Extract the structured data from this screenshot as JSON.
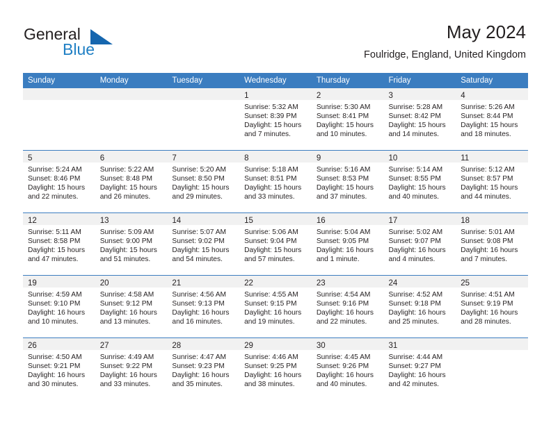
{
  "brand": {
    "name_part1": "General",
    "name_part2": "Blue",
    "triangle_icon": "triangle-icon",
    "accent_color": "#1666ae",
    "blue_text_color": "#1f7fc4"
  },
  "header": {
    "title": "May 2024",
    "subtitle": "Foulridge, England, United Kingdom"
  },
  "theme": {
    "header_row_bg": "#3b7dc0",
    "daynum_band_bg": "#f1f1f1",
    "text_color": "#231f20"
  },
  "weekdays": [
    "Sunday",
    "Monday",
    "Tuesday",
    "Wednesday",
    "Thursday",
    "Friday",
    "Saturday"
  ],
  "weeks": [
    [
      {
        "day": "",
        "lines": []
      },
      {
        "day": "",
        "lines": []
      },
      {
        "day": "",
        "lines": []
      },
      {
        "day": "1",
        "lines": [
          "Sunrise: 5:32 AM",
          "Sunset: 8:39 PM",
          "Daylight: 15 hours and 7 minutes."
        ]
      },
      {
        "day": "2",
        "lines": [
          "Sunrise: 5:30 AM",
          "Sunset: 8:41 PM",
          "Daylight: 15 hours and 10 minutes."
        ]
      },
      {
        "day": "3",
        "lines": [
          "Sunrise: 5:28 AM",
          "Sunset: 8:42 PM",
          "Daylight: 15 hours and 14 minutes."
        ]
      },
      {
        "day": "4",
        "lines": [
          "Sunrise: 5:26 AM",
          "Sunset: 8:44 PM",
          "Daylight: 15 hours and 18 minutes."
        ]
      }
    ],
    [
      {
        "day": "5",
        "lines": [
          "Sunrise: 5:24 AM",
          "Sunset: 8:46 PM",
          "Daylight: 15 hours and 22 minutes."
        ]
      },
      {
        "day": "6",
        "lines": [
          "Sunrise: 5:22 AM",
          "Sunset: 8:48 PM",
          "Daylight: 15 hours and 26 minutes."
        ]
      },
      {
        "day": "7",
        "lines": [
          "Sunrise: 5:20 AM",
          "Sunset: 8:50 PM",
          "Daylight: 15 hours and 29 minutes."
        ]
      },
      {
        "day": "8",
        "lines": [
          "Sunrise: 5:18 AM",
          "Sunset: 8:51 PM",
          "Daylight: 15 hours and 33 minutes."
        ]
      },
      {
        "day": "9",
        "lines": [
          "Sunrise: 5:16 AM",
          "Sunset: 8:53 PM",
          "Daylight: 15 hours and 37 minutes."
        ]
      },
      {
        "day": "10",
        "lines": [
          "Sunrise: 5:14 AM",
          "Sunset: 8:55 PM",
          "Daylight: 15 hours and 40 minutes."
        ]
      },
      {
        "day": "11",
        "lines": [
          "Sunrise: 5:12 AM",
          "Sunset: 8:57 PM",
          "Daylight: 15 hours and 44 minutes."
        ]
      }
    ],
    [
      {
        "day": "12",
        "lines": [
          "Sunrise: 5:11 AM",
          "Sunset: 8:58 PM",
          "Daylight: 15 hours and 47 minutes."
        ]
      },
      {
        "day": "13",
        "lines": [
          "Sunrise: 5:09 AM",
          "Sunset: 9:00 PM",
          "Daylight: 15 hours and 51 minutes."
        ]
      },
      {
        "day": "14",
        "lines": [
          "Sunrise: 5:07 AM",
          "Sunset: 9:02 PM",
          "Daylight: 15 hours and 54 minutes."
        ]
      },
      {
        "day": "15",
        "lines": [
          "Sunrise: 5:06 AM",
          "Sunset: 9:04 PM",
          "Daylight: 15 hours and 57 minutes."
        ]
      },
      {
        "day": "16",
        "lines": [
          "Sunrise: 5:04 AM",
          "Sunset: 9:05 PM",
          "Daylight: 16 hours and 1 minute."
        ]
      },
      {
        "day": "17",
        "lines": [
          "Sunrise: 5:02 AM",
          "Sunset: 9:07 PM",
          "Daylight: 16 hours and 4 minutes."
        ]
      },
      {
        "day": "18",
        "lines": [
          "Sunrise: 5:01 AM",
          "Sunset: 9:08 PM",
          "Daylight: 16 hours and 7 minutes."
        ]
      }
    ],
    [
      {
        "day": "19",
        "lines": [
          "Sunrise: 4:59 AM",
          "Sunset: 9:10 PM",
          "Daylight: 16 hours and 10 minutes."
        ]
      },
      {
        "day": "20",
        "lines": [
          "Sunrise: 4:58 AM",
          "Sunset: 9:12 PM",
          "Daylight: 16 hours and 13 minutes."
        ]
      },
      {
        "day": "21",
        "lines": [
          "Sunrise: 4:56 AM",
          "Sunset: 9:13 PM",
          "Daylight: 16 hours and 16 minutes."
        ]
      },
      {
        "day": "22",
        "lines": [
          "Sunrise: 4:55 AM",
          "Sunset: 9:15 PM",
          "Daylight: 16 hours and 19 minutes."
        ]
      },
      {
        "day": "23",
        "lines": [
          "Sunrise: 4:54 AM",
          "Sunset: 9:16 PM",
          "Daylight: 16 hours and 22 minutes."
        ]
      },
      {
        "day": "24",
        "lines": [
          "Sunrise: 4:52 AM",
          "Sunset: 9:18 PM",
          "Daylight: 16 hours and 25 minutes."
        ]
      },
      {
        "day": "25",
        "lines": [
          "Sunrise: 4:51 AM",
          "Sunset: 9:19 PM",
          "Daylight: 16 hours and 28 minutes."
        ]
      }
    ],
    [
      {
        "day": "26",
        "lines": [
          "Sunrise: 4:50 AM",
          "Sunset: 9:21 PM",
          "Daylight: 16 hours and 30 minutes."
        ]
      },
      {
        "day": "27",
        "lines": [
          "Sunrise: 4:49 AM",
          "Sunset: 9:22 PM",
          "Daylight: 16 hours and 33 minutes."
        ]
      },
      {
        "day": "28",
        "lines": [
          "Sunrise: 4:47 AM",
          "Sunset: 9:23 PM",
          "Daylight: 16 hours and 35 minutes."
        ]
      },
      {
        "day": "29",
        "lines": [
          "Sunrise: 4:46 AM",
          "Sunset: 9:25 PM",
          "Daylight: 16 hours and 38 minutes."
        ]
      },
      {
        "day": "30",
        "lines": [
          "Sunrise: 4:45 AM",
          "Sunset: 9:26 PM",
          "Daylight: 16 hours and 40 minutes."
        ]
      },
      {
        "day": "31",
        "lines": [
          "Sunrise: 4:44 AM",
          "Sunset: 9:27 PM",
          "Daylight: 16 hours and 42 minutes."
        ]
      },
      {
        "day": "",
        "lines": []
      }
    ]
  ]
}
